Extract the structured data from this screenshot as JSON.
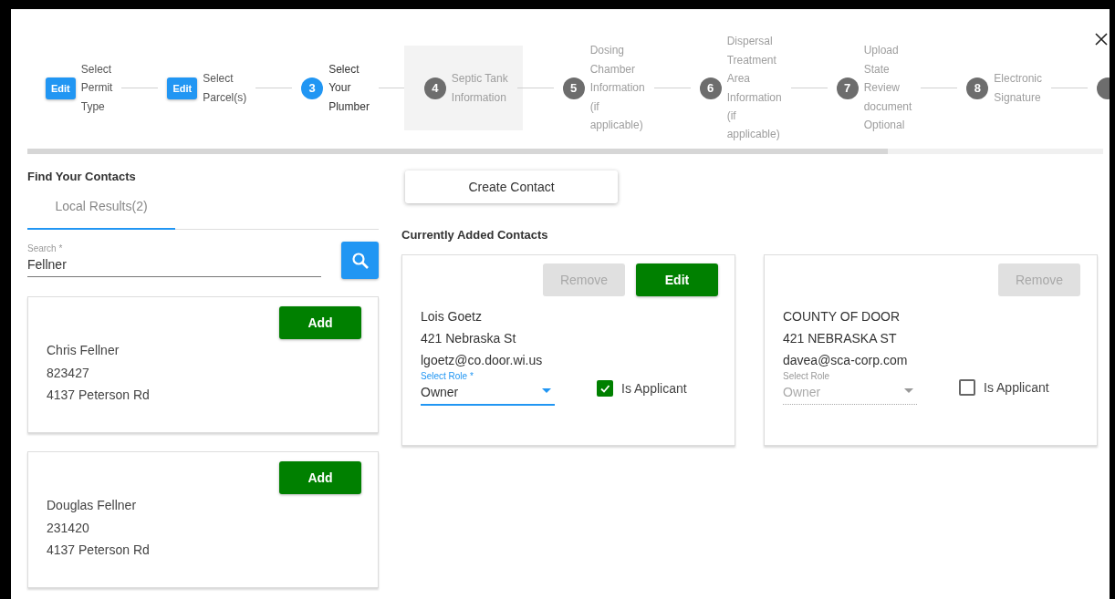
{
  "stepper": {
    "steps": [
      {
        "done": true,
        "badge": "Edit",
        "label_lines": [
          "Select",
          "Permit",
          "Type"
        ],
        "highlighted": false
      },
      {
        "done": true,
        "badge": "Edit",
        "label_lines": [
          "Select",
          "Parcel(s)"
        ],
        "highlighted": false
      },
      {
        "done": false,
        "active": true,
        "number": "3",
        "label_lines": [
          "Select",
          "Your",
          "Plumber"
        ],
        "highlighted": false
      },
      {
        "done": false,
        "active": false,
        "number": "4",
        "label_lines": [
          "Septic Tank",
          "Information"
        ],
        "highlighted": true
      },
      {
        "done": false,
        "active": false,
        "number": "5",
        "label_lines": [
          "Dosing",
          "Chamber",
          "Information",
          "(if",
          "applicable)"
        ],
        "highlighted": false
      },
      {
        "done": false,
        "active": false,
        "number": "6",
        "label_lines": [
          "Dispersal",
          "Treatment",
          "Area",
          "Information",
          "(if",
          "applicable)"
        ],
        "highlighted": false
      },
      {
        "done": false,
        "active": false,
        "number": "7",
        "label_lines": [
          "Upload",
          "State",
          "Review",
          "document",
          "Optional"
        ],
        "highlighted": false
      },
      {
        "done": false,
        "active": false,
        "number": "8",
        "label_lines": [
          "Electronic",
          "Signature"
        ],
        "highlighted": false
      },
      {
        "done": false,
        "active": false,
        "highlighted": false
      }
    ],
    "progress": {
      "level": 0.8
    }
  },
  "find_contacts": {
    "title": "Find Your Contacts",
    "tabs": [
      {
        "label": "Local Results(2)",
        "selected": true
      }
    ],
    "search": {
      "label": "Search *",
      "value": "Fellner"
    },
    "results": [
      {
        "name": "Chris Fellner",
        "id": "823427",
        "address": "4137 Peterson Rd",
        "button": "Add"
      },
      {
        "name": "Douglas Fellner",
        "id": "231420",
        "address": "4137 Peterson Rd",
        "button": "Add"
      }
    ]
  },
  "create_button": "Create Contact",
  "added_contacts": {
    "title": "Currently Added Contacts",
    "contacts": [
      {
        "remove_button": "Remove",
        "remove_disabled": true,
        "edit_button": "Edit",
        "name": "Lois Goetz",
        "address": "421 Nebraska St",
        "email": "lgoetz@co.door.wi.us",
        "role": {
          "label": "Select Role *",
          "value": "Owner",
          "disabled": false
        },
        "applicant": {
          "label": "Is Applicant",
          "checked": true
        }
      },
      {
        "remove_button": "Remove",
        "remove_disabled": true,
        "name": "COUNTY OF DOOR",
        "address": "421 NEBRASKA ST",
        "email": "davea@sca-corp.com",
        "role": {
          "label": "Select Role",
          "value": "Owner",
          "disabled": true
        },
        "applicant": {
          "label": "Is Applicant",
          "checked": false
        }
      }
    ]
  }
}
